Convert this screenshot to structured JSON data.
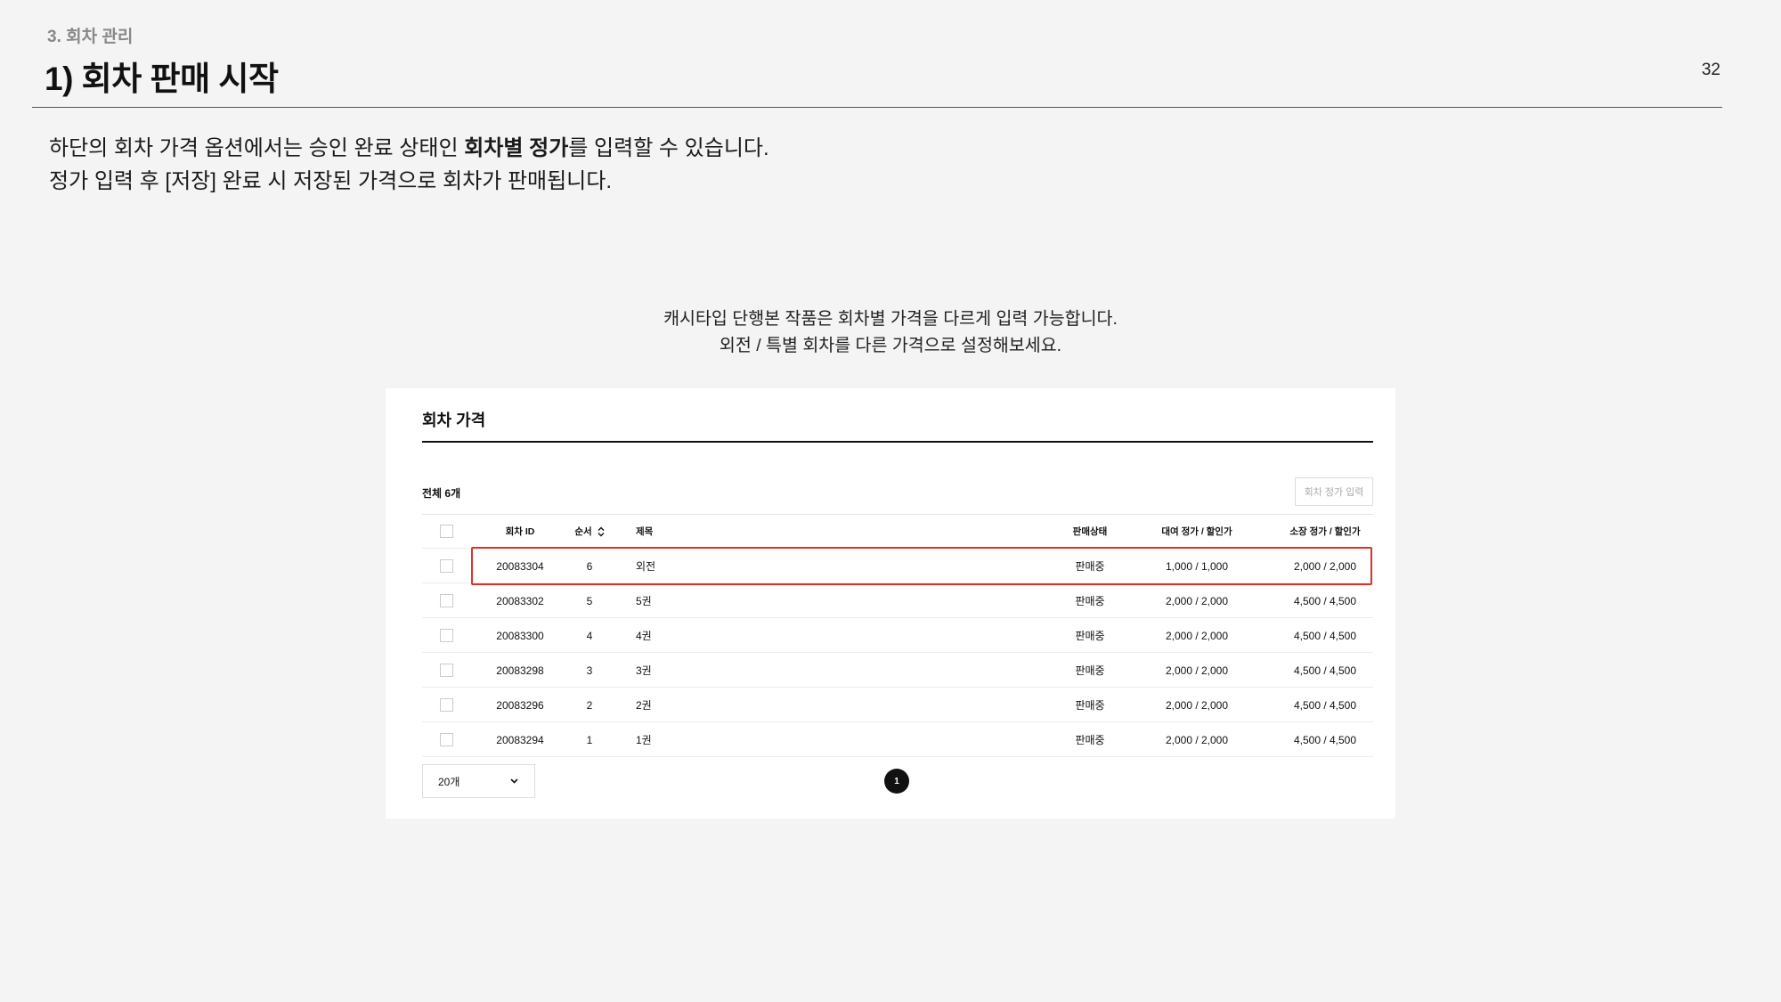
{
  "header": {
    "section": "3. 회차 관리",
    "title": "1) 회차 판매 시작",
    "page_number": "32"
  },
  "description": {
    "line1_pre": "하단의 회차 가격 옵션에서는 승인 완료 상태인 ",
    "line1_bold": "회차별 정가",
    "line1_post": "를 입력할 수 있습니다.",
    "line2": "정가 입력 후 [저장] 완료 시 저장된 가격으로 회차가 판매됩니다."
  },
  "caption": {
    "line1": "캐시타입 단행본 작품은 회차별 가격을 다르게 입력 가능합니다.",
    "line2": "외전 / 특별 회차를 다른 가격으로 설정해보세요."
  },
  "panel": {
    "title": "회차 가격",
    "total": "전체 6개",
    "price_button": "회차 정가 입력",
    "columns": {
      "id": "회차 ID",
      "order": "순서",
      "title": "제목",
      "status": "판매상태",
      "rent": "대여 정가 / 할인가",
      "own": "소장 정가 / 할인가"
    },
    "rows": [
      {
        "id": "20083304",
        "order": "6",
        "title": "외전",
        "status": "판매중",
        "rent": "1,000 / 1,000",
        "own": "2,000 / 2,000"
      },
      {
        "id": "20083302",
        "order": "5",
        "title": "5권",
        "status": "판매중",
        "rent": "2,000 / 2,000",
        "own": "4,500 / 4,500"
      },
      {
        "id": "20083300",
        "order": "4",
        "title": "4권",
        "status": "판매중",
        "rent": "2,000 / 2,000",
        "own": "4,500 / 4,500"
      },
      {
        "id": "20083298",
        "order": "3",
        "title": "3권",
        "status": "판매중",
        "rent": "2,000 / 2,000",
        "own": "4,500 / 4,500"
      },
      {
        "id": "20083296",
        "order": "2",
        "title": "2권",
        "status": "판매중",
        "rent": "2,000 / 2,000",
        "own": "4,500 / 4,500"
      },
      {
        "id": "20083294",
        "order": "1",
        "title": "1권",
        "status": "판매중",
        "rent": "2,000 / 2,000",
        "own": "4,500 / 4,500"
      }
    ],
    "per_page": "20개",
    "current_page": "1",
    "highlight_color": "#d9332b"
  }
}
